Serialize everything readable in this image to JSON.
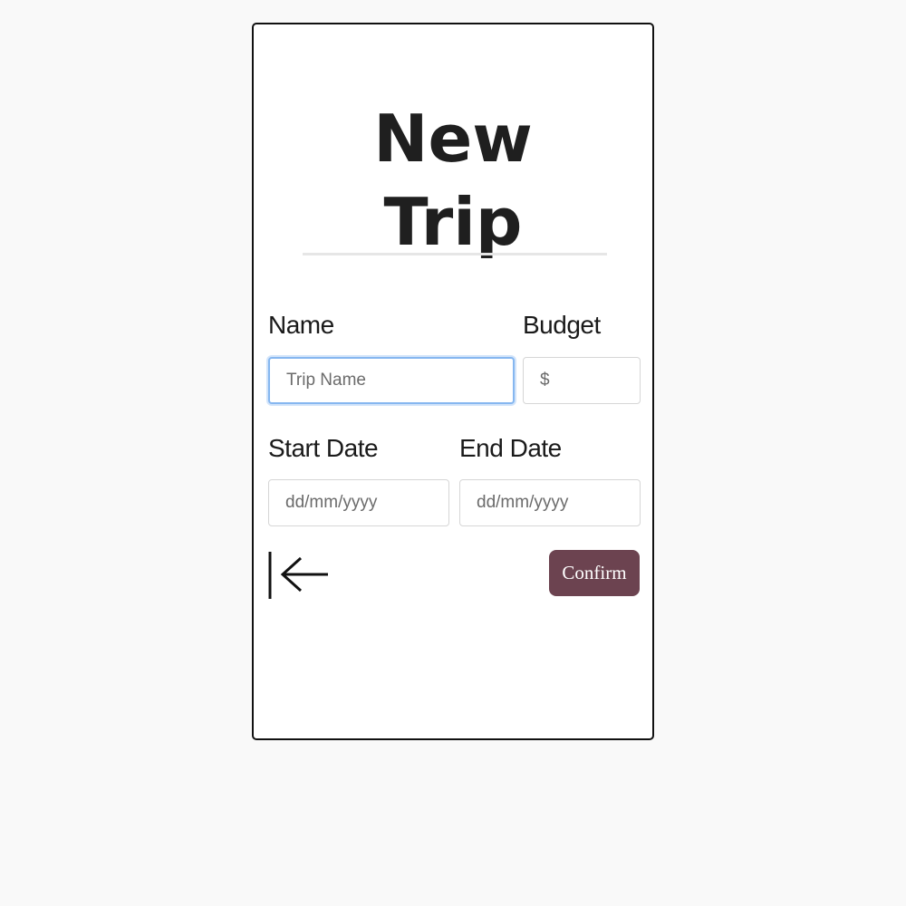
{
  "header": {
    "title_line1": "New",
    "title_line2": "Trip"
  },
  "form": {
    "name": {
      "label": "Name",
      "placeholder": "Trip Name",
      "value": ""
    },
    "budget": {
      "label": "Budget",
      "placeholder": "$",
      "value": ""
    },
    "start_date": {
      "label": "Start Date",
      "placeholder": "dd/mm/yyyy",
      "value": ""
    },
    "end_date": {
      "label": "End Date",
      "placeholder": "dd/mm/yyyy",
      "value": ""
    }
  },
  "actions": {
    "back_icon": "arrow-left-to-bar-icon",
    "confirm_label": "Confirm"
  },
  "colors": {
    "confirm_button": "#6c4350",
    "focus_ring": "#86b7f0",
    "card_border": "#111111",
    "page_background": "#f9f9f9"
  }
}
